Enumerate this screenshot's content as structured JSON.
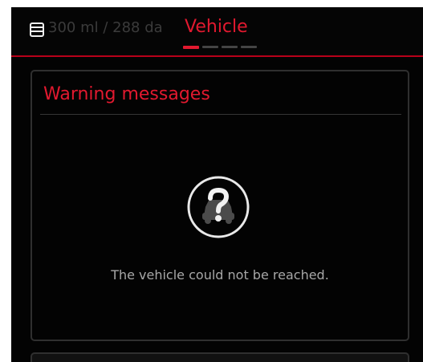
{
  "header": {
    "service_icon": "service-document-icon",
    "service_summary": "300 ml / 288 da",
    "title": "Vehicle",
    "page_indicator": {
      "count": 4,
      "active_index": 0
    },
    "colors": {
      "accent": "#e2192f",
      "divider": "#b8001a"
    }
  },
  "warning_card": {
    "title": "Warning messages",
    "status_icon": "vehicle-unreachable-question-icon",
    "status_message": "The vehicle could not be reached."
  }
}
